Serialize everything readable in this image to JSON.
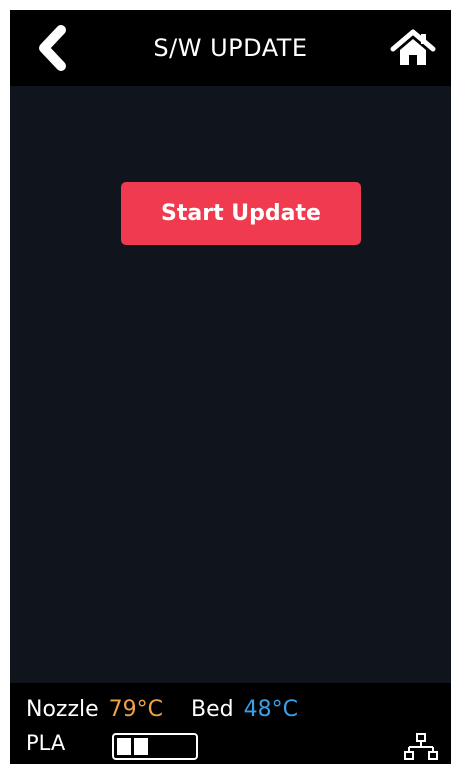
{
  "header": {
    "title": "S/W UPDATE",
    "back_icon": "chevron-left-icon",
    "home_icon": "home-icon"
  },
  "main": {
    "start_update_label": "Start Update"
  },
  "status_bar": {
    "nozzle_label": "Nozzle",
    "nozzle_temp": "79°C",
    "bed_label": "Bed",
    "bed_temp": "48°C",
    "material": "PLA",
    "filament_level": 0.35,
    "network_icon": "network-icon"
  },
  "colors": {
    "accent_button": "#ef3a4f",
    "nozzle_temp": "#f0a24a",
    "bed_temp": "#3aa0e8",
    "background": "#0f141d",
    "bars": "#000000"
  }
}
